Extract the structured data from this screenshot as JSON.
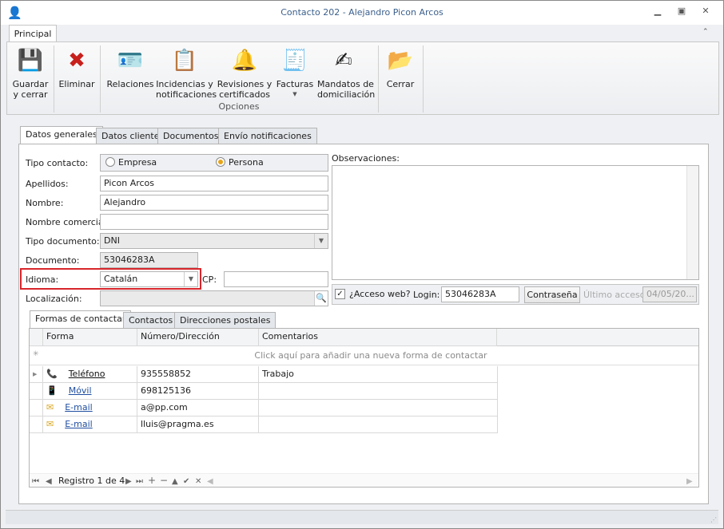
{
  "window": {
    "title": "Contacto 202 - Alejandro Picon Arcos"
  },
  "ribbon": {
    "tab": "Principal",
    "group_label": "Opciones",
    "buttons": {
      "save": "Guardar\ny cerrar",
      "delete": "Eliminar",
      "relations": "Relaciones",
      "incidents": "Incidencias y\nnotificaciones",
      "reviews": "Revisiones y\ncertificados",
      "invoices": "Facturas",
      "mandates": "Mandatos de\ndomiciliación",
      "close": "Cerrar"
    }
  },
  "tabs": [
    "Datos generales",
    "Datos cliente",
    "Documentos",
    "Envío notificaciones"
  ],
  "form": {
    "tipo_label": "Tipo contacto:",
    "opt_empresa": "Empresa",
    "opt_persona": "Persona",
    "tipo_selected": "Persona",
    "apellidos_label": "Apellidos:",
    "apellidos": "Picon Arcos",
    "nombre_label": "Nombre:",
    "nombre": "Alejandro",
    "comercial_label": "Nombre comercial:",
    "comercial": "",
    "tipodoc_label": "Tipo documento:",
    "tipodoc": "DNI",
    "documento_label": "Documento:",
    "documento": "53046283A",
    "idioma_label": "Idioma:",
    "idioma": "Catalán",
    "cp_label": "CP:",
    "cp": "",
    "localizacion_label": "Localización:",
    "localizacion": "",
    "observaciones_label": "Observaciones:",
    "observaciones": "",
    "acceso_label": "¿Acceso web?",
    "acceso_checked": true,
    "login_label": "Login:",
    "login": "53046283A",
    "password_button": "Contraseña",
    "ultimo_label": "Último acceso:",
    "ultimo": "04/05/20..."
  },
  "subtabs": [
    "Formas de contactar",
    "Contactos",
    "Direcciones postales"
  ],
  "grid": {
    "columns": [
      "Forma",
      "Número/Dirección",
      "Comentarios"
    ],
    "new_row": "Click aquí para añadir una nueva forma de contactar",
    "rows": [
      {
        "icon": "phone",
        "forma": "Teléfono",
        "valor": "935558852",
        "comentarios": "Trabajo"
      },
      {
        "icon": "mobile",
        "forma": "Móvil",
        "valor": "698125136",
        "comentarios": ""
      },
      {
        "icon": "email",
        "forma": "E-mail",
        "valor": "a@pp.com",
        "comentarios": ""
      },
      {
        "icon": "email",
        "forma": "E-mail",
        "valor": "lluis@pragma.es",
        "comentarios": ""
      }
    ],
    "navigator": "Registro 1 de 4"
  }
}
